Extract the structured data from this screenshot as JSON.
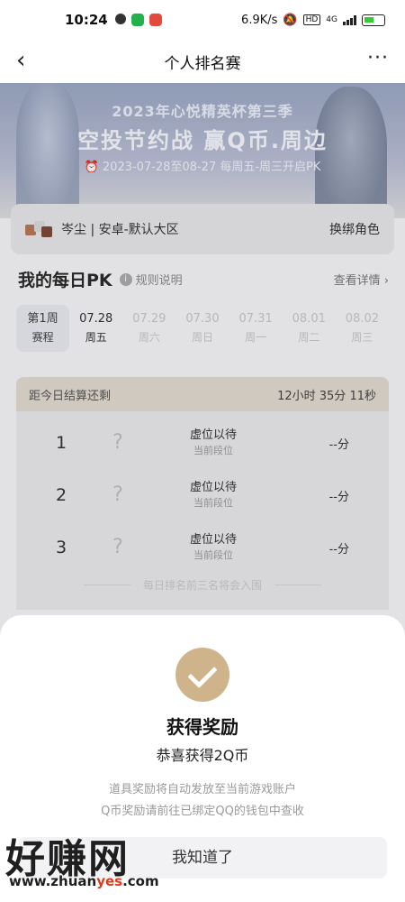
{
  "status_bar": {
    "time": "10:24",
    "network_speed": "6.9K/s",
    "network_type": "4G",
    "battery_icon": "battery-icon"
  },
  "nav": {
    "title": "个人排名赛",
    "back_icon": "chevron-left-icon",
    "more_label": "···"
  },
  "banner": {
    "line1": "2023年心悦精英杯第三季",
    "line2": "空投节约战 赢Q币.周边",
    "line3": "⏰ 2023-07-28至08-27 每周五-周三开启PK"
  },
  "role": {
    "name": "岑尘 | 安卓-默认大区",
    "switch_label": "换绑角色"
  },
  "pk": {
    "title": "我的每日PK",
    "info_icon": "i",
    "rule_label": "规则说明",
    "detail_label": "查看详情 ›"
  },
  "days": [
    {
      "top": "第1周",
      "bottom": "赛程"
    },
    {
      "top": "07.28",
      "bottom": "周五"
    },
    {
      "top": "07.29",
      "bottom": "周六"
    },
    {
      "top": "07.30",
      "bottom": "周日"
    },
    {
      "top": "07.31",
      "bottom": "周一"
    },
    {
      "top": "08.01",
      "bottom": "周二"
    },
    {
      "top": "08.02",
      "bottom": "周三"
    }
  ],
  "countdown": {
    "label": "距今日结算还剩",
    "value": "12小时 35分 11秒"
  },
  "ranks": [
    {
      "num": "1",
      "placeholder": "?",
      "name": "虚位以待",
      "tier": "当前段位",
      "score": "--分"
    },
    {
      "num": "2",
      "placeholder": "?",
      "name": "虚位以待",
      "tier": "当前段位",
      "score": "--分"
    },
    {
      "num": "3",
      "placeholder": "?",
      "name": "虚位以待",
      "tier": "当前段位",
      "score": "--分"
    }
  ],
  "rank_note": "每日排名前三名将会入围",
  "modal": {
    "title": "获得奖励",
    "subtitle": "恭喜获得2Q币",
    "desc1": "道具奖励将自动发放至当前游戏账户",
    "desc2": "Q币奖励请前往已绑定QQ的钱包中查收",
    "button": "我知道了"
  },
  "watermark": {
    "big": "好赚网",
    "url_prefix": "www.zhuan",
    "url_highlight": "yes",
    "url_suffix": ".com"
  },
  "colors": {
    "accent_gold": "#cfb48b",
    "countdown_bg": "#dfd9cf",
    "watermark_red": "#e03a1c"
  }
}
